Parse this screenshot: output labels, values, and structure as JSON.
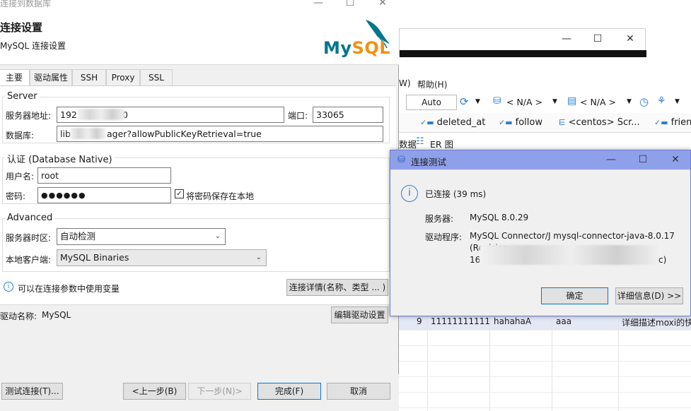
{
  "main_dialog": {
    "window_title": "连接到数据库",
    "header_title": "连接设置",
    "header_subtitle": "MySQL 连接设置",
    "logo_text": "MySQL",
    "tabs": [
      {
        "label": "主要"
      },
      {
        "label": "驱动属性"
      },
      {
        "label": "SSH"
      },
      {
        "label": "Proxy"
      },
      {
        "label": "SSL"
      }
    ],
    "server_group": {
      "title": "Server",
      "host_label": "服务器地址:",
      "host_value": "192",
      "host_value_tail": "0",
      "port_label": "端口:",
      "port_value": "33065",
      "db_label": "数据库:",
      "db_value_head": "lib",
      "db_value_tail": "ager?allowPublicKeyRetrieval=true"
    },
    "auth_group": {
      "title": "认证 (Database Native)",
      "user_label": "用户名:",
      "user_value": "root",
      "pwd_label": "密码:",
      "pwd_value": "●●●●●●",
      "save_pwd_label": "将密码保存在本地",
      "save_pwd_checked": true
    },
    "advanced_group": {
      "title": "Advanced",
      "tz_label": "服务器时区:",
      "tz_value": "自动检测",
      "client_label": "本地客户端:",
      "client_value": "MySQL Binaries"
    },
    "info_text": "可以在连接参数中使用变量",
    "conn_details_button": "连接详情(名称、类型 ... )",
    "driver_label": "驱动名称:",
    "driver_value": "MySQL",
    "edit_driver_button": "编辑驱动设置",
    "buttons": {
      "test": "测试连接(T)...",
      "back": "<上一步(B)",
      "next": "下一步(N)>",
      "finish": "完成(F)",
      "cancel": "取消"
    }
  },
  "background_app": {
    "menu_partial": "W)",
    "menu_help": "帮助(H)",
    "toolbar": {
      "auto_value": "Auto",
      "na_1": "< N/A >",
      "na_2": "< N/A >"
    },
    "columns": [
      "deleted_at",
      "follow",
      "<centos> Scr...",
      "friend"
    ],
    "tabs": [
      "数据",
      "ER 图"
    ],
    "row": {
      "num": "9",
      "c1": "11111111111",
      "c2": "hahahaA",
      "c3": "aaa",
      "c4": "详细描述moxi的快"
    }
  },
  "popup": {
    "title": "连接测试",
    "status": "已连接 (39 ms)",
    "server_label": "服务器:",
    "server_value": "MySQL 8.0.29",
    "driver_label": "驱动程序:",
    "driver_line1": "MySQL Connector/J mysql-connector-java-8.0.17",
    "driver_line2": "(Revision:",
    "driver_line3_head": "16",
    "driver_line3_tail": "c)",
    "ok_button": "确定",
    "details_button": "详细信息(D) >>"
  },
  "colors": {
    "accent_blue": "#0078d7",
    "popup_title_bg": "#8fa0ea",
    "mysql_blue": "#00758f",
    "mysql_orange": "#f29111",
    "icon_blue": "#2a7fd4"
  }
}
